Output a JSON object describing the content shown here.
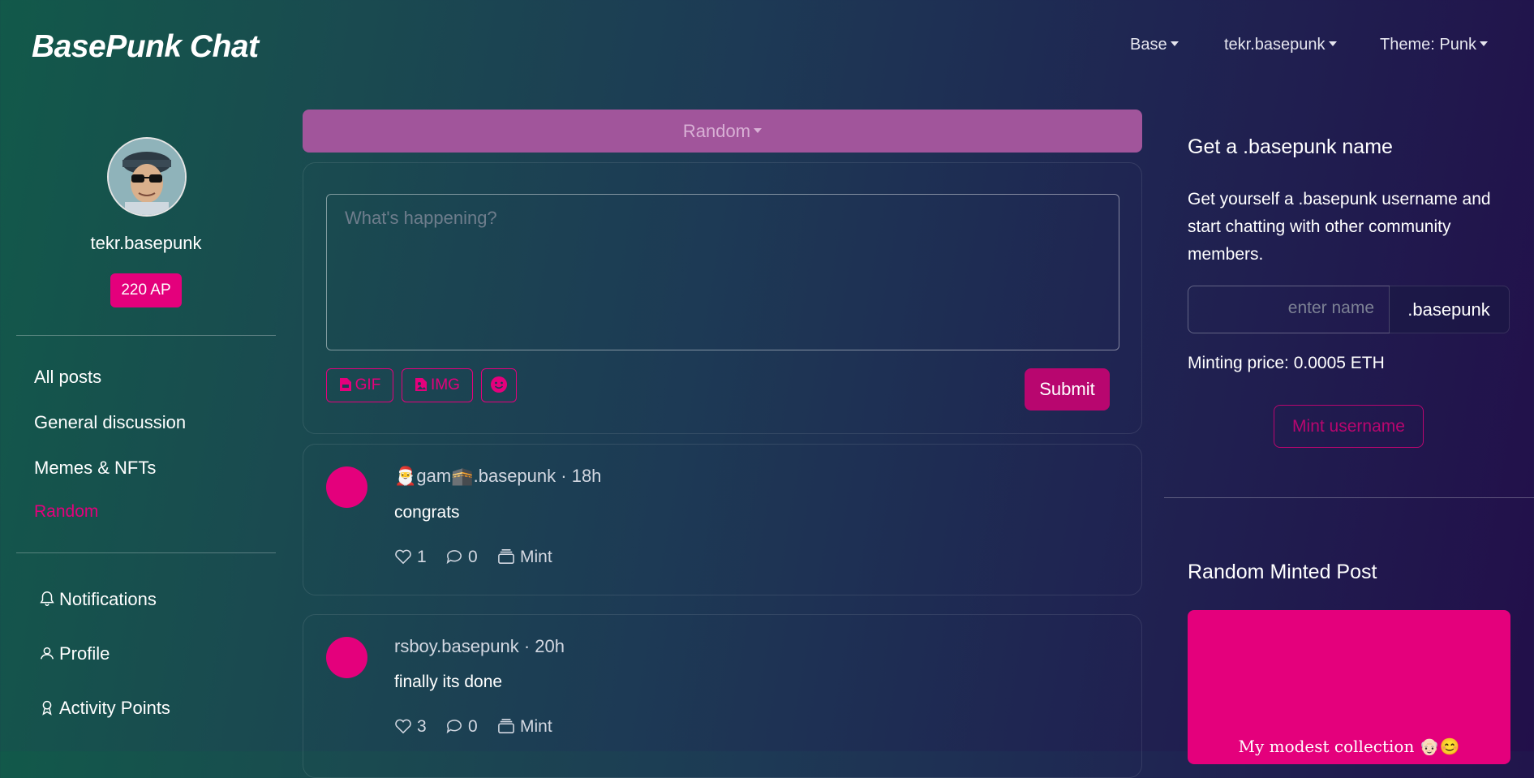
{
  "header": {
    "brand": "BasePunk Chat",
    "network": "Base",
    "account": "tekr.basepunk",
    "theme": "Theme: Punk"
  },
  "profile": {
    "username": "tekr.basepunk",
    "ap": "220 AP"
  },
  "sidebar": {
    "channels": [
      {
        "label": "All posts",
        "active": false
      },
      {
        "label": "General discussion",
        "active": false
      },
      {
        "label": "Memes & NFTs",
        "active": false
      },
      {
        "label": "Random",
        "active": true
      }
    ],
    "links": [
      {
        "label": "Notifications",
        "icon": "bell-icon"
      },
      {
        "label": "Profile",
        "icon": "user-icon"
      },
      {
        "label": "Activity Points",
        "icon": "award-icon"
      }
    ]
  },
  "composer": {
    "channel": "Random",
    "placeholder": "What's happening?",
    "gif_label": "GIF",
    "img_label": "IMG",
    "emoji_icon": "smile-icon",
    "submit_label": "Submit"
  },
  "posts": [
    {
      "author_prefix_emoji": "🎅",
      "author_mid": "gam",
      "author_mid_emoji": "🕋",
      "author_suffix": ".basepunk",
      "time": "18h",
      "text": "congrats",
      "likes": "1",
      "comments": "0",
      "mint_label": "Mint"
    },
    {
      "author": "rsboy.basepunk",
      "time": "20h",
      "text": "finally its done",
      "likes": "3",
      "comments": "0",
      "mint_label": "Mint"
    }
  ],
  "right": {
    "name_title": "Get a .basepunk name",
    "name_desc": "Get yourself a .basepunk username and start chatting with other community members.",
    "input_placeholder": "enter name",
    "suffix": ".basepunk",
    "minting_price": "Minting price: 0.0005 ETH",
    "mint_label": "Mint username",
    "random_title": "Random Minted Post",
    "random_text": "My modest collection 👴🏻😊"
  },
  "colors": {
    "accent": "#e4007c",
    "accent_dark": "#b8066f",
    "channel_button": "#a1559b"
  }
}
